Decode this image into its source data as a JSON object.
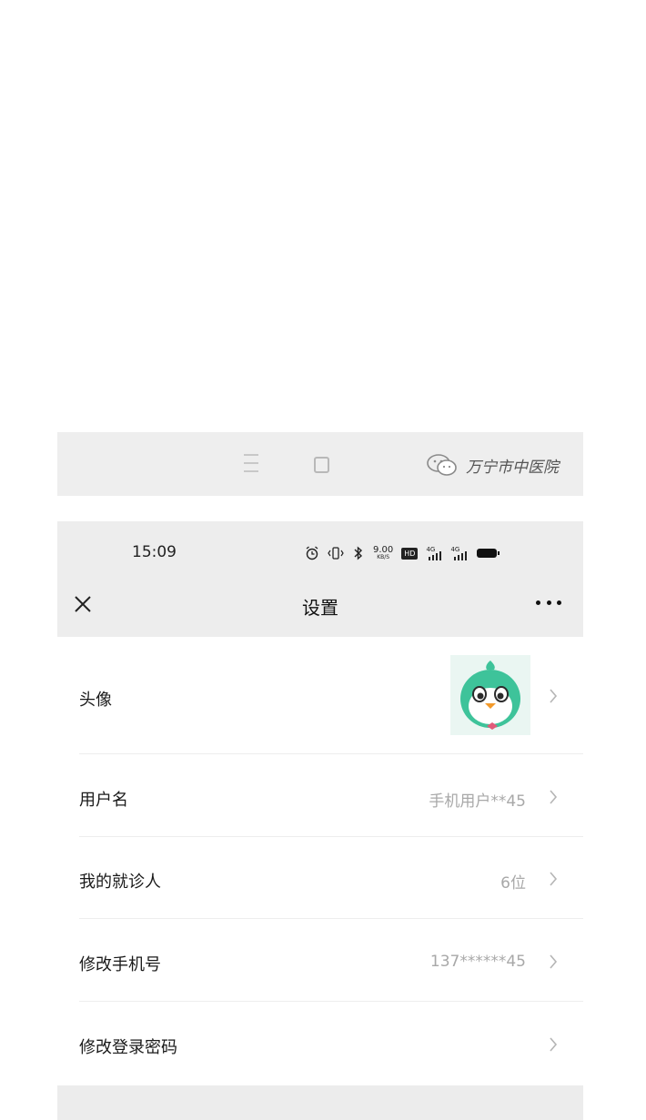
{
  "system_nav": {
    "menu_icon": "menu-icon",
    "home_icon": "square-home-icon",
    "watermark_icon": "wechat-icon",
    "watermark_text": "万宁市中医院"
  },
  "status_bar": {
    "time": "15:09",
    "icons": [
      "alarm-icon",
      "vibrate-icon",
      "bluetooth-icon",
      "net-speed",
      "hd-icon",
      "signal-4g-icon",
      "signal-5g-icon",
      "battery-icon"
    ],
    "net_speed": "9.00",
    "net_speed_unit": "KB/S",
    "hd_label": "HD",
    "signal1_label": "4G",
    "signal2_label": "4G"
  },
  "header": {
    "title": "设置",
    "close_icon": "close-icon",
    "more_icon": "more-dots-icon"
  },
  "settings": {
    "items": [
      {
        "label": "头像",
        "value": ""
      },
      {
        "label": "用户名",
        "value": "手机用户**45"
      },
      {
        "label": "我的就诊人",
        "value": "6位"
      },
      {
        "label": "修改手机号",
        "value": "137******45"
      },
      {
        "label": "修改登录密码",
        "value": ""
      }
    ]
  },
  "colors": {
    "header_bg": "#ededed",
    "row_bg": "#ffffff",
    "value_text": "#a8a8a8",
    "avatar_green": "#3ec39a"
  }
}
